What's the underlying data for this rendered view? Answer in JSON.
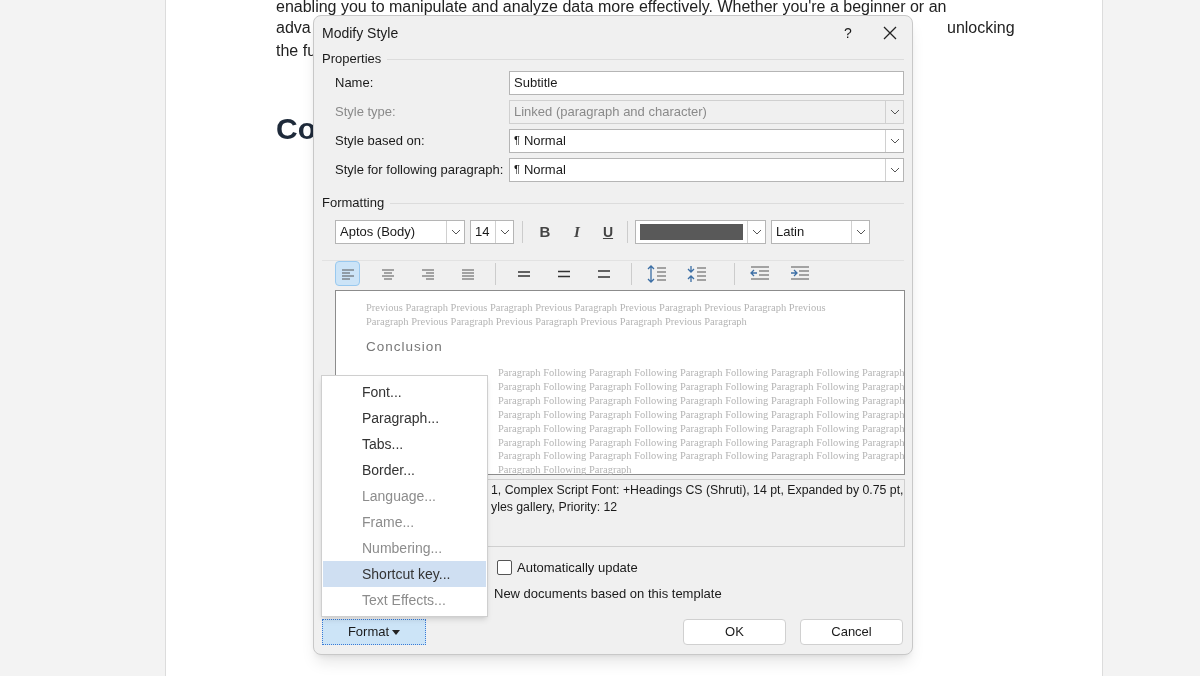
{
  "document": {
    "lines": [
      "enabling you to manipulate and analyze data more effectively. Whether you're a beginner or an"
    ],
    "left_fragments": [
      "adva",
      "the fu"
    ],
    "right_fragment": "unlocking",
    "heading": "Co"
  },
  "dialog": {
    "title": "Modify Style",
    "help": "?",
    "properties": {
      "label": "Properties",
      "fields": [
        {
          "label": "Name:",
          "kind": "text",
          "value": "Subtitle",
          "disabled": false
        },
        {
          "label": "Style type:",
          "kind": "combo",
          "value": "Linked (paragraph and character)",
          "disabled": true
        },
        {
          "label": "Style based on:",
          "kind": "combo",
          "mark": "¶",
          "value": "Normal",
          "disabled": false
        },
        {
          "label": "Style for following paragraph:",
          "kind": "combo",
          "mark": "¶",
          "value": "Normal",
          "disabled": false
        }
      ]
    },
    "formatting": {
      "label": "Formatting",
      "font": "Aptos (Body)",
      "size": "14",
      "bold": "B",
      "italic": "I",
      "underline": "U",
      "color": "#595959",
      "script": "Latin",
      "alignment": [
        {
          "kind": "left",
          "selected": true
        },
        {
          "kind": "center",
          "selected": false
        },
        {
          "kind": "right",
          "selected": false
        },
        {
          "kind": "justify",
          "selected": false
        }
      ]
    },
    "preview": {
      "previous": "Previous Paragraph Previous Paragraph Previous Paragraph Previous Paragraph Previous Paragraph Previous Paragraph Previous Paragraph Previous Paragraph Previous Paragraph Previous Paragraph",
      "heading": "Conclusion",
      "following": [
        "Paragraph Following Paragraph Following Paragraph Following Paragraph Following Paragraph",
        "Paragraph Following Paragraph Following Paragraph Following Paragraph Following Paragraph",
        "Paragraph Following Paragraph Following Paragraph Following Paragraph Following Paragraph",
        "Paragraph Following Paragraph Following Paragraph Following Paragraph Following Paragraph",
        "Paragraph Following Paragraph Following Paragraph Following Paragraph Following Paragraph",
        "Paragraph Following Paragraph Following Paragraph Following Paragraph Following Paragraph",
        "Paragraph Following Paragraph Following Paragraph Following Paragraph Following Paragraph",
        "Paragraph Following Paragraph"
      ]
    },
    "description": [
      "1, Complex Script Font: +Headings CS (Shruti), 14 pt, Expanded by  0.75 pt,",
      "yles gallery, Priority: 12"
    ],
    "auto_update": {
      "label": "Automatically update",
      "checked": false
    },
    "new_documents": "New documents based on this template",
    "format_button": "Format",
    "buttons": [
      "OK",
      "Cancel"
    ]
  },
  "format_menu": [
    {
      "label": "Font...",
      "disabled": false,
      "selected": false
    },
    {
      "label": "Paragraph...",
      "disabled": false,
      "selected": false
    },
    {
      "label": "Tabs...",
      "disabled": false,
      "selected": false
    },
    {
      "label": "Border...",
      "disabled": false,
      "selected": false
    },
    {
      "label": "Language...",
      "disabled": true,
      "selected": false
    },
    {
      "label": "Frame...",
      "disabled": true,
      "selected": false
    },
    {
      "label": "Numbering...",
      "disabled": true,
      "selected": false
    },
    {
      "label": "Shortcut key...",
      "disabled": false,
      "selected": true
    },
    {
      "label": "Text Effects...",
      "disabled": true,
      "selected": false
    }
  ]
}
